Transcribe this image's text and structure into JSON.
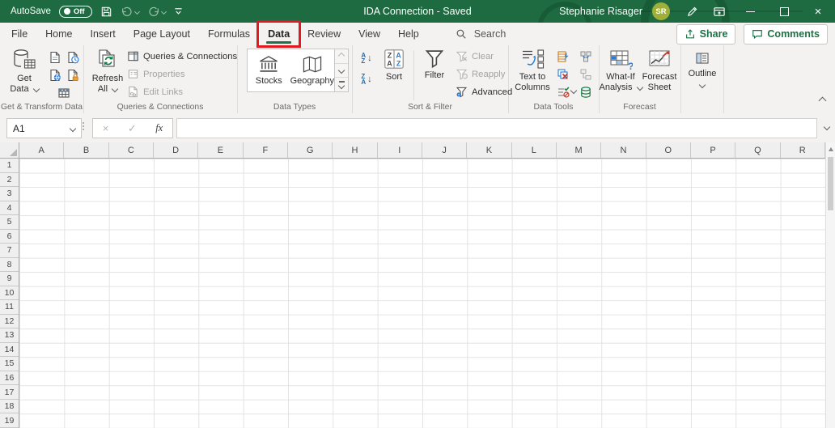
{
  "colors": {
    "titlebar": "#1E6B41",
    "accent": "#1E7145",
    "annotation_red": "#E11A22",
    "ribbon_bg": "#F3F2F1",
    "header_bg": "#EFEFEF",
    "gridline": "#E3E3E3",
    "disabled_text": "#A3A3A3",
    "icon_blue": "#2B7CD3",
    "icon_green": "#107C41",
    "icon_orange": "#C77B21",
    "icon_red": "#C0392B",
    "avatar_bg": "#9FAF38"
  },
  "titlebar": {
    "autosave_label": "AutoSave",
    "autosave_state": "Off",
    "title": "IDA Connection  -  Saved",
    "user_name": "Stephanie Risager",
    "avatar_initials": "SR"
  },
  "tab_bar": {
    "tabs": [
      "File",
      "Home",
      "Insert",
      "Page Layout",
      "Formulas",
      "Data",
      "Review",
      "View",
      "Help"
    ],
    "selected_tab": "Data",
    "search_label": "Search",
    "share_label": "Share",
    "comments_label": "Comments"
  },
  "ribbon": {
    "get_transform": {
      "get_data_line1": "Get",
      "get_data_line2": "Data",
      "group_label": "Get & Transform Data"
    },
    "queries": {
      "refresh_line1": "Refresh",
      "refresh_line2": "All",
      "items": [
        {
          "label": "Queries & Connections",
          "enabled": true
        },
        {
          "label": "Properties",
          "enabled": false
        },
        {
          "label": "Edit Links",
          "enabled": false
        }
      ],
      "group_label": "Queries & Connections"
    },
    "data_types": {
      "items": [
        "Stocks",
        "Geography"
      ],
      "group_label": "Data Types"
    },
    "sort_filter": {
      "sort_label": "Sort",
      "filter_label": "Filter",
      "clear_label": "Clear",
      "reapply_label": "Reapply",
      "advanced_label": "Advanced",
      "group_label": "Sort & Filter"
    },
    "data_tools": {
      "text_to_columns_line1": "Text to",
      "text_to_columns_line2": "Columns",
      "group_label": "Data Tools"
    },
    "forecast": {
      "whatif_line1": "What-If",
      "whatif_line2": "Analysis",
      "sheet_line1": "Forecast",
      "sheet_line2": "Sheet",
      "group_label": "Forecast"
    },
    "outline": {
      "label": "Outline"
    }
  },
  "formula_bar": {
    "name_box_value": "A1",
    "fx_label": "fx",
    "formula_value": ""
  },
  "glyphs": {
    "close": "×",
    "cancel": "×",
    "check": "✓",
    "sort_arrow_down": "↓",
    "az_a": "A",
    "az_z": "Z"
  },
  "grid": {
    "columns": [
      "A",
      "B",
      "C",
      "D",
      "E",
      "F",
      "G",
      "H",
      "I",
      "J",
      "K",
      "L",
      "M",
      "N",
      "O",
      "P",
      "Q",
      "R"
    ],
    "rows": [
      "1",
      "2",
      "3",
      "4",
      "5",
      "6",
      "7",
      "8",
      "9",
      "10",
      "11",
      "12",
      "13",
      "14",
      "15",
      "16",
      "17",
      "18",
      "19"
    ]
  }
}
